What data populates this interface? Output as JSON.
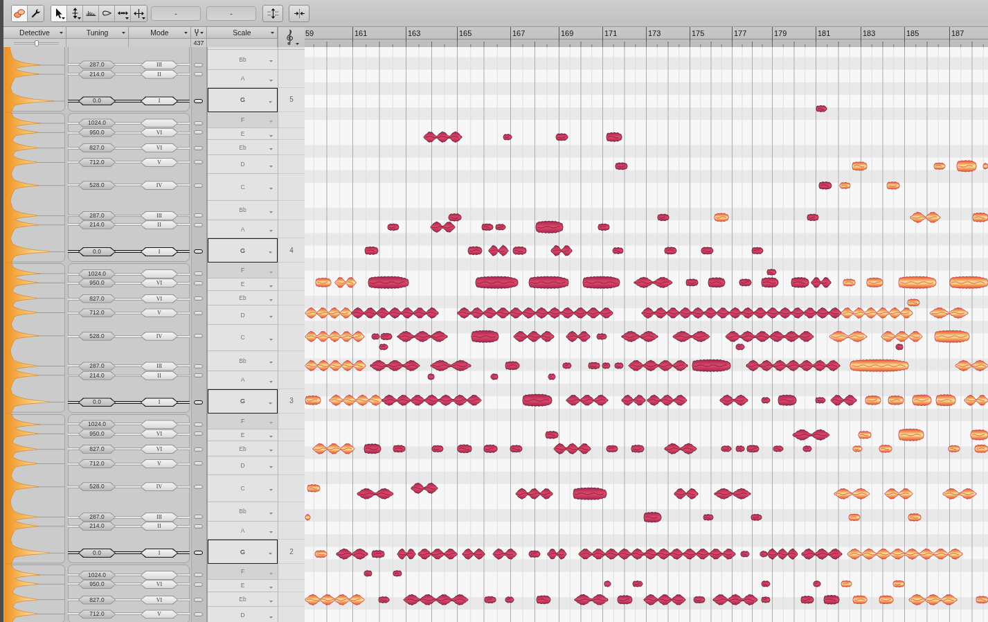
{
  "toolbar": {
    "modes": [
      {
        "selected": true
      },
      {
        "selected": false
      }
    ],
    "tools": [
      {
        "selected": true
      },
      {
        "selected": false
      },
      {
        "selected": false
      },
      {
        "selected": false
      },
      {
        "selected": false
      },
      {
        "selected": false
      }
    ],
    "fields": [
      {
        "value": "-"
      },
      {
        "value": "-"
      }
    ]
  },
  "header": {
    "detective": "Detective",
    "tuning": "Tuning",
    "mode": "Mode",
    "scale": "Scale",
    "detective_slider": {
      "level": 0.5
    },
    "reference_pitch": "437"
  },
  "ruler": {
    "bars": [
      "59",
      "161",
      "163",
      "165",
      "167",
      "169",
      "171",
      "173",
      "175",
      "177",
      "179",
      "181",
      "183",
      "185",
      "187"
    ]
  },
  "scale": [
    {
      "octave": "5",
      "notes": [
        {
          "name": "Bb",
          "tuning": "287.0",
          "degree": "III",
          "enabled": true,
          "tonic": false
        },
        {
          "name": "A",
          "tuning": "214.0",
          "degree": "II",
          "enabled": true,
          "tonic": false
        },
        {
          "name": "G",
          "tuning": "0.0",
          "degree": "I",
          "enabled": true,
          "tonic": true
        }
      ]
    },
    {
      "octave": "4",
      "notes": [
        {
          "name": "F",
          "tuning": "1024.0",
          "enabled": false,
          "tonic": false
        },
        {
          "name": "E",
          "tuning": "950.0",
          "degree": "VI",
          "enabled": true,
          "tonic": false
        },
        {
          "name": "Eb",
          "tuning": "827.0",
          "degree": "VI",
          "enabled": true,
          "tonic": false
        },
        {
          "name": "D",
          "tuning": "712.0",
          "degree": "V",
          "enabled": true,
          "tonic": false
        },
        {
          "name": "C",
          "tuning": "528.0",
          "degree": "IV",
          "enabled": true,
          "tonic": false
        },
        {
          "name": "Bb",
          "tuning": "287.0",
          "degree": "III",
          "enabled": true,
          "tonic": false
        },
        {
          "name": "A",
          "tuning": "214.0",
          "degree": "II",
          "enabled": true,
          "tonic": false
        },
        {
          "name": "G",
          "tuning": "0.0",
          "degree": "I",
          "enabled": true,
          "tonic": true
        }
      ]
    },
    {
      "octave": "3",
      "notes": [
        {
          "name": "F",
          "tuning": "1024.0",
          "enabled": false,
          "tonic": false
        },
        {
          "name": "E",
          "tuning": "950.0",
          "degree": "VI",
          "enabled": true,
          "tonic": false
        },
        {
          "name": "Eb",
          "tuning": "827.0",
          "degree": "VI",
          "enabled": true,
          "tonic": false
        },
        {
          "name": "D",
          "tuning": "712.0",
          "degree": "V",
          "enabled": true,
          "tonic": false
        },
        {
          "name": "C",
          "tuning": "528.0",
          "degree": "IV",
          "enabled": true,
          "tonic": false
        },
        {
          "name": "Bb",
          "tuning": "287.0",
          "degree": "III",
          "enabled": true,
          "tonic": false
        },
        {
          "name": "A",
          "tuning": "214.0",
          "degree": "II",
          "enabled": true,
          "tonic": false
        },
        {
          "name": "G",
          "tuning": "0.0",
          "degree": "I",
          "enabled": true,
          "tonic": true
        }
      ]
    },
    {
      "octave": "2",
      "notes": [
        {
          "name": "F",
          "tuning": "1024.0",
          "enabled": false,
          "tonic": false
        },
        {
          "name": "E",
          "tuning": "950.0",
          "degree": "VI",
          "enabled": true,
          "tonic": false
        },
        {
          "name": "Eb",
          "tuning": "827.0",
          "degree": "VI",
          "enabled": true,
          "tonic": false
        },
        {
          "name": "D",
          "tuning": "712.0",
          "degree": "V",
          "enabled": true,
          "tonic": false
        },
        {
          "name": "C",
          "tuning": "528.0",
          "degree": "IV",
          "enabled": true,
          "tonic": false
        },
        {
          "name": "Bb",
          "tuning": "287.0",
          "degree": "III",
          "enabled": true,
          "tonic": false
        },
        {
          "name": "A",
          "tuning": "214.0",
          "degree": "II",
          "enabled": true,
          "tonic": false
        },
        {
          "name": "G",
          "tuning": "0.0",
          "degree": "I",
          "enabled": true,
          "tonic": true
        }
      ]
    },
    {
      "notes": [
        {
          "name": "F",
          "tuning": "1024.0",
          "enabled": false,
          "tonic": false
        },
        {
          "name": "E",
          "tuning": "950.0",
          "degree": "VI",
          "enabled": true,
          "tonic": false
        },
        {
          "name": "Eb",
          "tuning": "827.0",
          "degree": "VI",
          "enabled": true,
          "tonic": false
        },
        {
          "name": "D",
          "tuning": "712.0",
          "degree": "V",
          "enabled": true,
          "tonic": false
        }
      ]
    }
  ]
}
